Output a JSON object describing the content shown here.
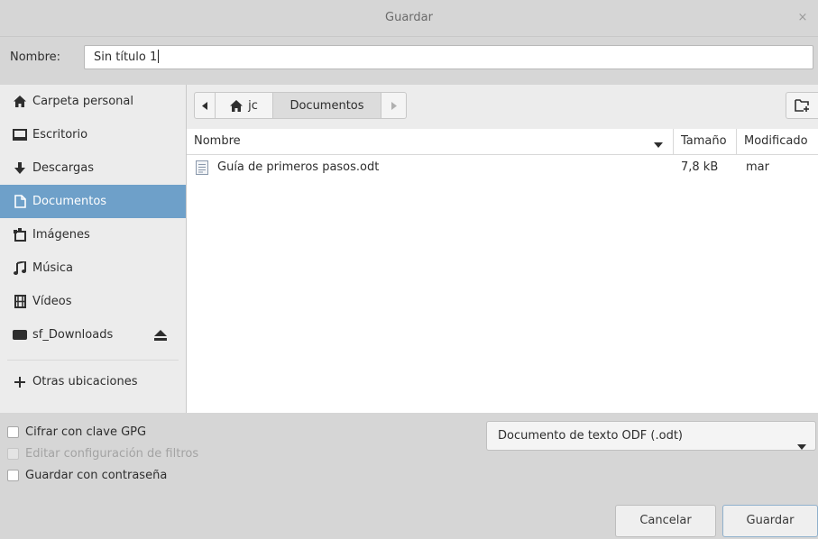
{
  "window": {
    "title": "Guardar",
    "close_glyph": "×"
  },
  "name_field": {
    "label": "Nombre:",
    "value": "Sin título 1"
  },
  "sidebar": {
    "items": [
      {
        "label": "Carpeta personal",
        "icon": "home-icon"
      },
      {
        "label": "Escritorio",
        "icon": "desktop-icon"
      },
      {
        "label": "Descargas",
        "icon": "download-icon"
      },
      {
        "label": "Documentos",
        "icon": "document-icon",
        "selected": true
      },
      {
        "label": "Imágenes",
        "icon": "pictures-icon"
      },
      {
        "label": "Música",
        "icon": "music-icon"
      },
      {
        "label": "Vídeos",
        "icon": "video-icon"
      },
      {
        "label": "sf_Downloads",
        "icon": "drive-icon",
        "eject": true
      },
      {
        "label": "Otras ubicaciones",
        "icon": "plus-icon"
      }
    ],
    "selected_color": "#6ea0c9"
  },
  "pathbar": {
    "home_label": "jc",
    "current": "Documentos"
  },
  "columns": {
    "name": "Nombre",
    "size": "Tamaño",
    "modified": "Modificado"
  },
  "files": [
    {
      "name": "Guía de primeros pasos.odt",
      "size": "7,8 kB",
      "modified": "mar"
    }
  ],
  "options": {
    "encrypt": "Cifrar con clave GPG",
    "edit_filter": "Editar configuración de filtros",
    "password": "Guardar con contraseña"
  },
  "filetype": {
    "selected": "Documento de texto ODF (.odt)"
  },
  "buttons": {
    "cancel": "Cancelar",
    "save": "Guardar"
  }
}
